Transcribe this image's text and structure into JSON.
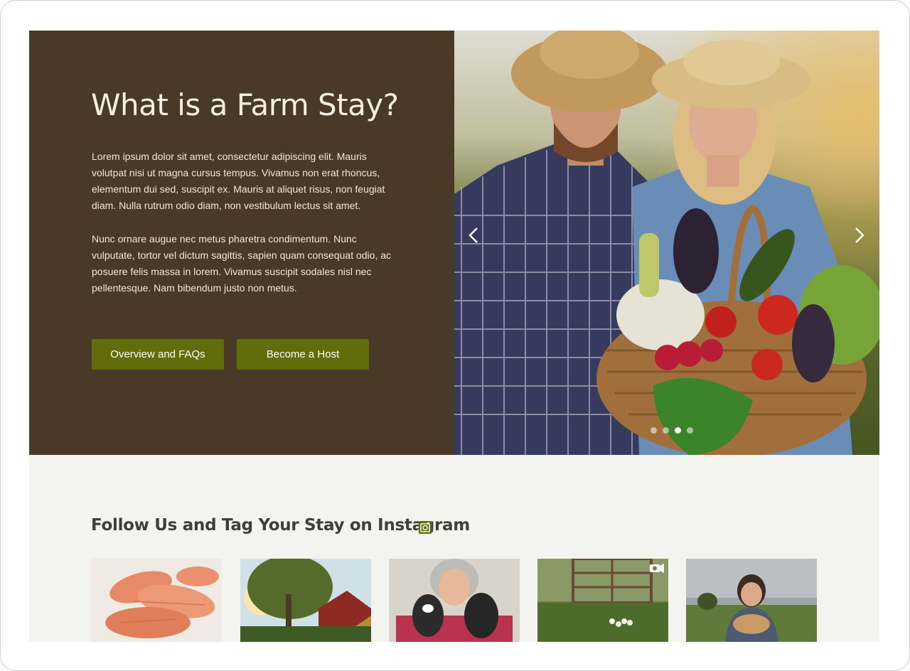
{
  "hero": {
    "title": "What is a Farm Stay?",
    "paragraph_1": "Lorem ipsum dolor sit amet, consectetur adipiscing elit. Mauris volutpat nisi ut magna cursus tempus. Vivamus non erat rhoncus, elementum dui sed, suscipit ex. Mauris at aliquet risus, non feugiat diam. Nulla rutrum odio diam, non vestibulum lectus sit amet.",
    "paragraph_2": "Nunc ornare augue nec metus pharetra condimentum. Nunc vulputate, tortor vel dictum sagittis, sapien quam consequat odio, ac posuere felis massa in lorem. Vivamus suscipit sodales nisl nec pellentesque. Nam bibendum justo non metus.",
    "buttons": {
      "overview_label": "Overview and FAQs",
      "host_label": "Become a Host"
    },
    "carousel": {
      "slide_count": 4,
      "active_slide": 3
    }
  },
  "instagram": {
    "heading": "Follow Us and Tag Your Stay on Instagram"
  },
  "colors": {
    "hero_background": "#483a26",
    "button_green": "#626c0a",
    "section_background": "#f3f3ef",
    "heading_text": "#3f3f3a"
  },
  "icons": [
    "chevron-left-icon",
    "chevron-right-icon",
    "instagram-icon",
    "video-camera-icon"
  ]
}
